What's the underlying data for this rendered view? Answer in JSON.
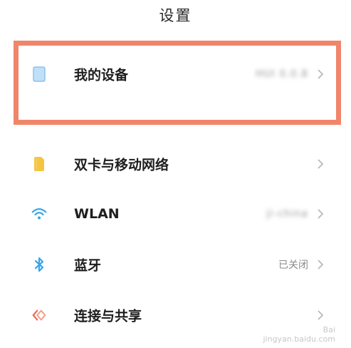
{
  "header": {
    "title": "设置"
  },
  "rows": [
    {
      "label": "我的设备",
      "value": "",
      "icon": "phone-icon",
      "value_blurred": true
    },
    {
      "label": "双卡与移动网络",
      "value": "",
      "icon": "sim-card-icon"
    },
    {
      "label": "WLAN",
      "value": "",
      "icon": "wifi-icon",
      "value_blurred": true
    },
    {
      "label": "蓝牙",
      "value": "已关闭",
      "icon": "bluetooth-icon"
    },
    {
      "label": "连接与共享",
      "value": "",
      "icon": "share-icon"
    }
  ],
  "watermark": {
    "line1": "Bai",
    "line2": "jingyan.baidu.com"
  },
  "colors": {
    "highlight": "#f0856a",
    "phone_icon": "#bfe0f7",
    "sim_icon": "#f5c542",
    "wifi_icon": "#3aa6e8",
    "bluetooth_icon": "#3aa6e8",
    "share_icon": "#ea6b52"
  }
}
